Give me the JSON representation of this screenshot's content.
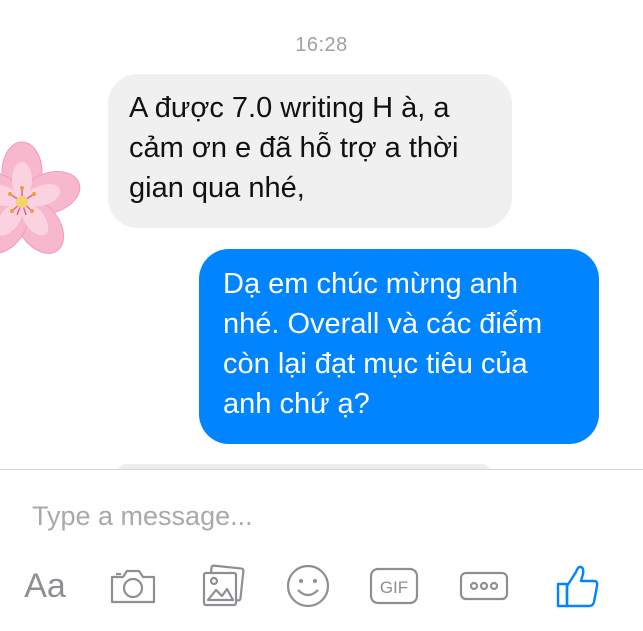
{
  "conversation": {
    "timestamp": "16:28",
    "messages": [
      {
        "direction": "incoming",
        "lines": [
          "A được 7.0 writing H à, a",
          "cảm ơn e đã hỗ trợ a thời",
          "gian qua nhé,"
        ]
      },
      {
        "direction": "outgoing",
        "lines": [
          "Dạ em chúc mừng anh",
          "nhé. Overall và các điểm",
          "còn lại đạt mục tiêu của",
          "anh chứ ạ?"
        ]
      }
    ]
  },
  "composer": {
    "placeholder": "Type a message...",
    "text_format_label": "Aa",
    "gif_label": "GIF",
    "icons": [
      "text-format-icon",
      "camera-icon",
      "gallery-icon",
      "emoji-icon",
      "gif-icon",
      "more-icon",
      "like-icon"
    ]
  },
  "colors": {
    "incoming_bubble": "#f0f0f0",
    "outgoing_bubble": "#0084ff",
    "accent": "#0084ff",
    "icon_gray": "#8e8e93",
    "timestamp": "#a0a0a4"
  }
}
